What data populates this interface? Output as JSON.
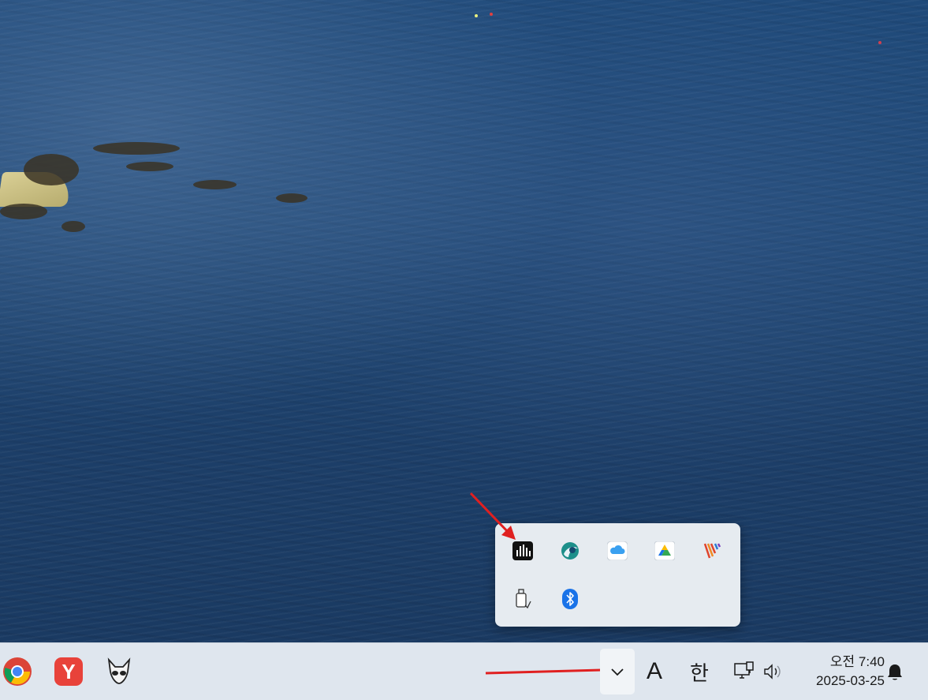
{
  "tray_overflow": {
    "icons": [
      {
        "name": "audio-visualizer-icon"
      },
      {
        "name": "browser-swirl-icon"
      },
      {
        "name": "icloud-icon"
      },
      {
        "name": "google-drive-icon"
      },
      {
        "name": "colorful-stripes-app-icon"
      },
      {
        "name": "usb-drive-icon"
      },
      {
        "name": "bluetooth-icon"
      }
    ]
  },
  "taskbar": {
    "pinned_apps": [
      {
        "name": "chrome-icon"
      },
      {
        "name": "yandex-browser-icon",
        "glyph": "Y"
      },
      {
        "name": "alien-app-icon"
      }
    ],
    "input_language": "A",
    "ime_mode": "한",
    "clock": {
      "time": "오전 7:40",
      "date": "2025-03-25"
    }
  },
  "colors": {
    "taskbar_bg": "#dfe6ee",
    "popup_bg": "#e6ebf0",
    "annotation_arrow": "#e02020",
    "bluetooth_blue": "#1a73e8"
  }
}
